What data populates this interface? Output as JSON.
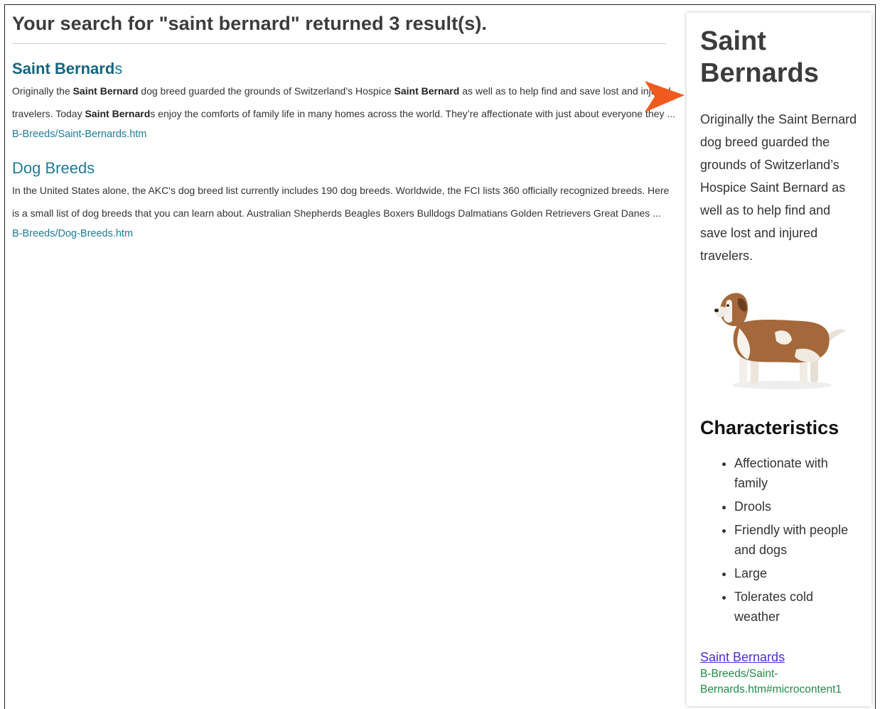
{
  "results": {
    "heading": "Your search for \"saint bernard\" returned 3 result(s).",
    "items": [
      {
        "title_bold": "Saint Bernard",
        "title_rest": "s",
        "snippet_parts": [
          "Originally the ",
          "Saint Bernard",
          " dog breed guarded the grounds of Switzerland’s Hospice ",
          "Saint Bernard",
          " as well as to help find and save lost and injured travelers. Today ",
          "Saint Bernard",
          "s enjoy the comforts of family life in many homes across the world. They’re affectionate with just about everyone they ..."
        ],
        "url": "B-Breeds/Saint-Bernards.htm"
      },
      {
        "title": "Dog Breeds",
        "snippet": "In the United States alone, the AKC's dog breed list currently includes 190 dog breeds. Worldwide, the FCI lists 360 officially recognized breeds. Here is a small list of dog breeds that you can learn about. Australian Shepherds Beagles Boxers Bulldogs Dalmatians Golden Retrievers Great Danes ...",
        "url": "B-Breeds/Dog-Breeds.htm"
      }
    ]
  },
  "panel": {
    "title": "Saint Bernards",
    "description": "Originally the Saint Bernard dog breed guarded the grounds of Switzerland’s Hospice Saint Bernard as well as to help find and save lost and injured travelers.",
    "characteristics_heading": "Characteristics",
    "characteristics": [
      "Affectionate with family",
      "Drools",
      "Friendly with people and dogs",
      "Large",
      "Tolerates cold weather"
    ],
    "link_label": "Saint Bernards",
    "link_url": "B-Breeds/Saint-Bernards.htm#microcontent1"
  },
  "colors": {
    "link": "#1f7a99",
    "arrow": "#f05a1e",
    "panel_link": "#4b2fd6",
    "panel_url": "#228b48"
  }
}
